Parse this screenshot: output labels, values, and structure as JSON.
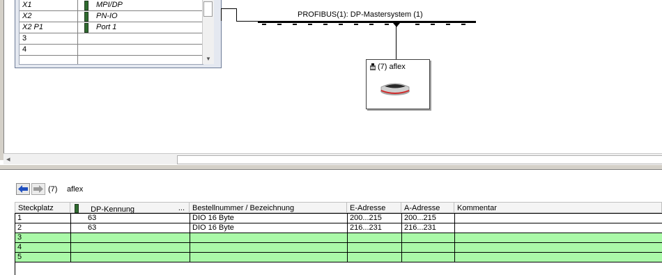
{
  "rack": {
    "rows": [
      {
        "slot": "X1",
        "module": "MPI/DP",
        "italic": true
      },
      {
        "slot": "X2",
        "module": "PN-IO",
        "italic": true
      },
      {
        "slot": "X2 P1",
        "module": "Port 1",
        "italic": true
      },
      {
        "slot": "3",
        "module": "",
        "italic": false
      },
      {
        "slot": "4",
        "module": "",
        "italic": false
      }
    ]
  },
  "bus": {
    "label": "PROFIBUS(1): DP-Mastersystem (1)"
  },
  "node": {
    "label": "(7) aflex"
  },
  "details": {
    "slot_number": "(7)",
    "device_name": "aflex",
    "columns": [
      "Steckplatz",
      "DP-Kennung",
      "...",
      "Bestellnummer / Bezeichnung",
      "E-Adresse",
      "A-Adresse",
      "Kommentar"
    ],
    "rows": [
      {
        "slot": "1",
        "dp_id": "63",
        "order": "DIO 16 Byte",
        "e_addr": "200...215",
        "a_addr": "200...215",
        "comment": "",
        "color": "white"
      },
      {
        "slot": "2",
        "dp_id": "63",
        "order": "DIO 16 Byte",
        "e_addr": "216...231",
        "a_addr": "216...231",
        "comment": "",
        "color": "white"
      },
      {
        "slot": "3",
        "dp_id": "",
        "order": "",
        "e_addr": "",
        "a_addr": "",
        "comment": "",
        "color": "green"
      },
      {
        "slot": "4",
        "dp_id": "",
        "order": "",
        "e_addr": "",
        "a_addr": "",
        "comment": "",
        "color": "green"
      },
      {
        "slot": "5",
        "dp_id": "",
        "order": "",
        "e_addr": "",
        "a_addr": "",
        "comment": "",
        "color": "green"
      }
    ]
  },
  "colors": {
    "slot_free": "#aaf9a8",
    "nav_arrow": "#1f4fbf"
  }
}
